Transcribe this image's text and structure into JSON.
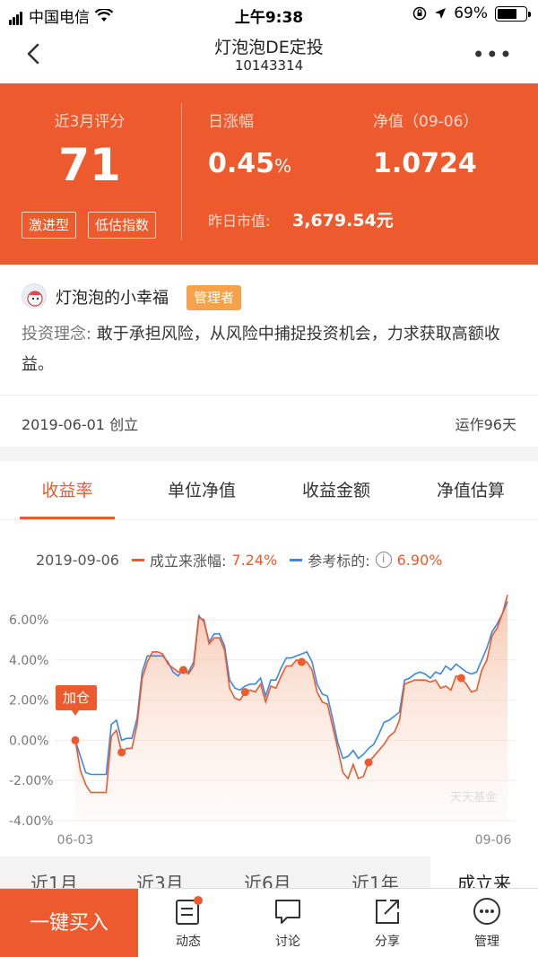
{
  "status": {
    "carrier": "中国电信",
    "time": "上午9:38",
    "battery": "69%"
  },
  "nav": {
    "title": "灯泡泡DE定投",
    "code": "10143314"
  },
  "hero": {
    "score_label": "近3月评分",
    "score": "71",
    "tags": [
      "激进型",
      "低估指数"
    ],
    "daily_label": "日涨幅",
    "daily_value": "0.45",
    "daily_unit": "%",
    "nav_label": "净值（09-06）",
    "nav_value": "1.0724",
    "mv_label": "昨日市值:",
    "mv_value": "3,679.54元"
  },
  "manager": {
    "name": "灯泡泡的小幸福",
    "badge": "管理者",
    "philosophy_key": "投资理念:",
    "philosophy": " 敢于承担风险，从风险中捕捉投资机会，力求获取高额收益。"
  },
  "info": {
    "created": "2019-06-01 创立",
    "running": "运作96天"
  },
  "tabs": [
    "收益率",
    "单位净值",
    "收益金额",
    "净值估算"
  ],
  "legend": {
    "date": "2019-09-06",
    "series1_label": "成立来涨幅:",
    "series1_value": "7.24%",
    "series2_label": "参考标的:",
    "series2_value": "6.90%"
  },
  "chart_data": {
    "type": "area",
    "x_start": "06-03",
    "x_end": "09-06",
    "ylim": [
      -4,
      7
    ],
    "yticks": [
      "6.00%",
      "4.00%",
      "2.00%",
      "0.00%",
      "-2.00%",
      "-4.00%"
    ],
    "ytick_values": [
      6,
      4,
      2,
      0,
      -2,
      -4
    ],
    "annotation": "加仓",
    "watermark": "天天基金",
    "series": [
      {
        "name": "成立来涨幅",
        "color": "#ec5a2e",
        "values": [
          0,
          -1.5,
          -2.2,
          -2.6,
          -2.6,
          -2.6,
          -2.6,
          0.2,
          0.5,
          -0.6,
          -0.4,
          -0.4,
          0.8,
          3.1,
          3.9,
          4.4,
          4.4,
          4.3,
          3.8,
          3.6,
          3.4,
          3.5,
          3.3,
          3.7,
          6.1,
          6.0,
          4.8,
          5.1,
          5.1,
          4.5,
          2.6,
          2.1,
          2.0,
          2.4,
          2.5,
          2.4,
          2.8,
          1.9,
          2.7,
          2.6,
          3.2,
          3.7,
          3.7,
          4.0,
          3.9,
          3.9,
          3.5,
          2.4,
          1.9,
          1.8,
          0.7,
          -0.4,
          -1.6,
          -1.9,
          -1.2,
          -1.9,
          -1.8,
          -1.1,
          -0.8,
          -0.5,
          -0.2,
          0.2,
          0.4,
          1.0,
          2.8,
          2.9,
          3.0,
          3.0,
          3.0,
          2.9,
          3.0,
          2.6,
          2.7,
          2.5,
          3.2,
          3.1,
          2.8,
          2.4,
          2.5,
          3.5,
          4.0,
          5.2,
          5.6,
          6.3,
          7.24
        ]
      },
      {
        "name": "参考标的",
        "color": "#3a87e6",
        "values": [
          0,
          -0.8,
          -1.6,
          -1.7,
          -1.7,
          -1.7,
          -1.7,
          0.8,
          1.0,
          0.0,
          0.1,
          0.1,
          1.1,
          3.4,
          4.2,
          4.2,
          4.2,
          4.2,
          3.9,
          3.4,
          3.2,
          3.6,
          3.4,
          3.9,
          6.2,
          5.9,
          4.9,
          5.3,
          5.3,
          4.7,
          3.0,
          2.6,
          2.5,
          2.7,
          2.8,
          2.8,
          3.1,
          2.2,
          3.0,
          3.0,
          3.6,
          4.1,
          4.1,
          4.2,
          4.3,
          4.4,
          3.9,
          2.8,
          2.3,
          2.2,
          1.1,
          -0.1,
          -0.9,
          -0.8,
          -0.5,
          -0.9,
          -0.7,
          -0.4,
          -0.2,
          0.3,
          0.9,
          1.0,
          1.2,
          1.4,
          3.0,
          3.1,
          3.3,
          3.4,
          3.3,
          3.1,
          3.4,
          3.3,
          3.7,
          3.5,
          3.8,
          3.6,
          3.4,
          3.3,
          3.4,
          4.0,
          4.6,
          5.4,
          5.8,
          6.3,
          6.9
        ]
      }
    ],
    "markers": [
      0,
      9,
      21,
      33,
      44,
      57,
      75
    ]
  },
  "periods": [
    "近1月",
    "近3月",
    "近6月",
    "近1年",
    "成立来"
  ],
  "bottom": {
    "buy": "一键买入",
    "items": [
      "动态",
      "讨论",
      "分享",
      "管理"
    ]
  }
}
